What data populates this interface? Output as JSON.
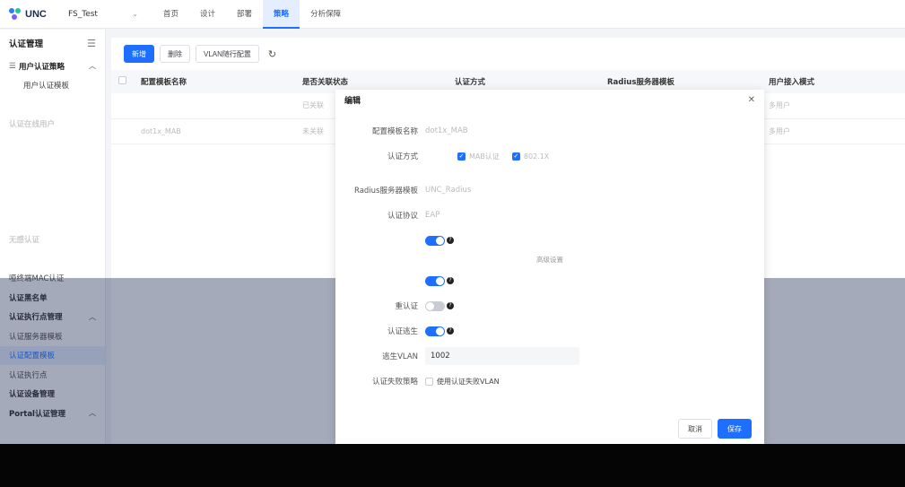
{
  "brand": {
    "name": "UNC"
  },
  "project": {
    "name": "FS_Test"
  },
  "nav": [
    {
      "label": "首页",
      "active": false
    },
    {
      "label": "设计",
      "active": false
    },
    {
      "label": "部署",
      "active": false
    },
    {
      "label": "策略",
      "active": true
    },
    {
      "label": "分析保障",
      "active": false
    }
  ],
  "sidebar": {
    "title": "认证管理",
    "items": [
      {
        "label": "用户认证策略",
        "type": "group"
      },
      {
        "label": "用户认证模板",
        "type": "sub"
      },
      {
        "label": "认证在线用户",
        "type": "group-faded"
      },
      {
        "label": "无感认证",
        "type": "group-faded"
      },
      {
        "label": "哑终端MAC认证",
        "type": "sub"
      },
      {
        "label": "认证黑名单",
        "type": "group"
      },
      {
        "label": "认证执行点管理",
        "type": "group"
      },
      {
        "label": "认证服务器模板",
        "type": "sub"
      },
      {
        "label": "认证配置模板",
        "type": "sub-active"
      },
      {
        "label": "认证执行点",
        "type": "sub"
      },
      {
        "label": "认证设备管理",
        "type": "group"
      },
      {
        "label": "Portal认证管理",
        "type": "group"
      }
    ]
  },
  "toolbar": {
    "add": "新增",
    "delete": "删除",
    "vlan": "VLAN随行配置"
  },
  "table": {
    "columns": [
      "配置模板名称",
      "是否关联状态",
      "认证方式",
      "Radius服务器模板",
      "用户接入模式"
    ],
    "rows": [
      {
        "name": "",
        "status": "已关联",
        "mode": "多用户"
      },
      {
        "name": "dot1x_MAB",
        "status": "未关联",
        "mode": "多用户"
      }
    ]
  },
  "dialog": {
    "title": "编辑",
    "template_name_label": "配置模板名称",
    "template_name_value": "dot1x_MAB",
    "auth_mode_label": "认证方式",
    "auth_mode_options": [
      "MAB认证",
      "802.1X"
    ],
    "radius_label": "Radius服务器模板",
    "radius_value": "UNC_Radius",
    "protocol_label": "认证协议",
    "protocol_value": "EAP",
    "advanced_link": "高级设置",
    "reauth_label": "重认证",
    "escape_label": "认证逃生",
    "escape_vlan_label": "逃生VLAN",
    "escape_vlan_value": "1002",
    "fail_policy_label": "认证失败策略",
    "fail_policy_option": "使用认证失败VLAN",
    "cancel": "取消",
    "save": "保存"
  }
}
